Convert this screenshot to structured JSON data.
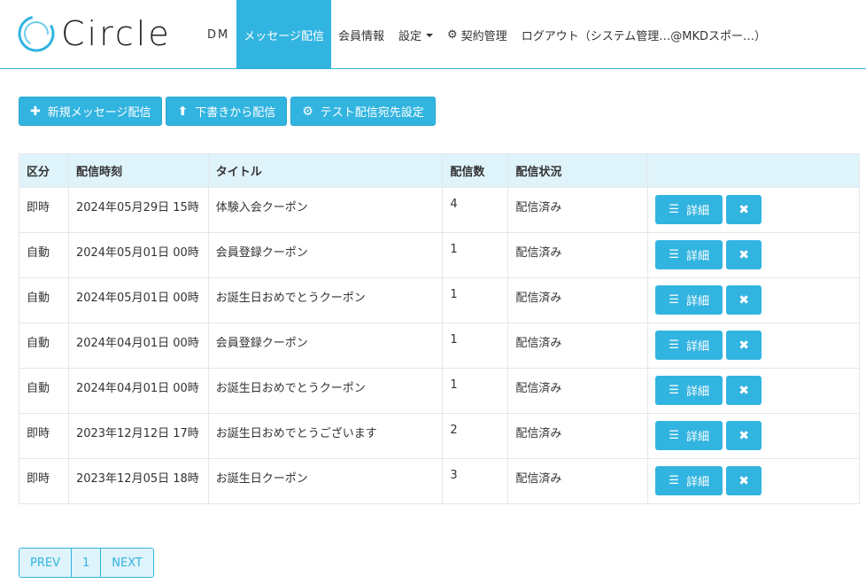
{
  "header": {
    "logo_text": "Circle",
    "nav": [
      {
        "label": "DM"
      },
      {
        "label": "メッセージ配信"
      },
      {
        "label": "会員情報"
      },
      {
        "label": "設定"
      },
      {
        "label": "契約管理"
      },
      {
        "label": "ログアウト（システム管理…@MKDスポー…）"
      }
    ]
  },
  "toolbar": {
    "new_label": "新規メッセージ配信",
    "draft_label": "下書きから配信",
    "test_label": "テスト配信宛先設定"
  },
  "table": {
    "headers": [
      "区分",
      "配信時刻",
      "タイトル",
      "配信数",
      "配信状況",
      ""
    ],
    "detail_label": "詳細",
    "rows": [
      {
        "type": "即時",
        "time": "2024年05月29日 15時",
        "title": "体験入会クーポン",
        "count": "4",
        "status": "配信済み"
      },
      {
        "type": "自動",
        "time": "2024年05月01日 00時",
        "title": "会員登録クーポン",
        "count": "1",
        "status": "配信済み"
      },
      {
        "type": "自動",
        "time": "2024年05月01日 00時",
        "title": "お誕生日おめでとうクーポン",
        "count": "1",
        "status": "配信済み"
      },
      {
        "type": "自動",
        "time": "2024年04月01日 00時",
        "title": "会員登録クーポン",
        "count": "1",
        "status": "配信済み"
      },
      {
        "type": "自動",
        "time": "2024年04月01日 00時",
        "title": "お誕生日おめでとうクーポン",
        "count": "1",
        "status": "配信済み"
      },
      {
        "type": "即時",
        "time": "2023年12月12日 17時",
        "title": "お誕生日おめでとうございます",
        "count": "2",
        "status": "配信済み"
      },
      {
        "type": "即時",
        "time": "2023年12月05日 18時",
        "title": "お誕生日クーポン",
        "count": "3",
        "status": "配信済み"
      }
    ]
  },
  "pagination": {
    "prev_label": "PREV",
    "current_page": "1",
    "next_label": "NEXT"
  },
  "colors": {
    "accent": "#32b4e0",
    "header_row_bg": "#dff3fb"
  },
  "icons": {
    "plus": "plus-icon",
    "upload": "upload-icon",
    "gear": "gear-icon",
    "list": "list-icon",
    "close": "close-icon",
    "caret": "caret-down-icon"
  }
}
